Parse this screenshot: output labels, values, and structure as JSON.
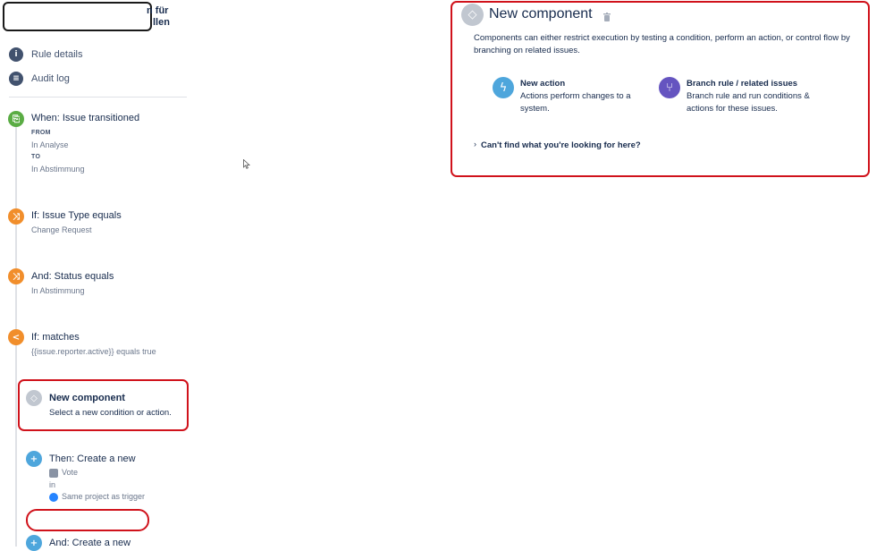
{
  "header": {
    "title_tail_line1": "n für",
    "title_tail_line2": "llen"
  },
  "nav": {
    "rule_details": "Rule details",
    "audit_log": "Audit log"
  },
  "timeline": {
    "trigger": {
      "title": "When: Issue transitioned",
      "from_label": "FROM",
      "from_value": "In Analyse",
      "to_label": "TO",
      "to_value": "In Abstimmung"
    },
    "cond1": {
      "title": "If: Issue Type equals",
      "sub": "Change Request"
    },
    "cond2": {
      "title": "And: Status equals",
      "sub": "In Abstimmung"
    },
    "cond3": {
      "title": "If: matches",
      "sub": "{{issue.reporter.active}} equals true"
    },
    "new_component": {
      "title": "New component",
      "sub": "Select a new condition or action."
    },
    "action1": {
      "title": "Then: Create a new",
      "type": "Vote",
      "in": "in",
      "project": "Same project as trigger"
    },
    "action2": {
      "title": "And: Create a new"
    }
  },
  "panel": {
    "title": "New component",
    "description": "Components can either restrict execution by testing a condition, perform an action, or control flow by branching on related issues.",
    "options": [
      {
        "title": "New action",
        "desc": "Actions perform changes to a system.",
        "icon": "lightning-icon",
        "color": "#4ea6dc"
      },
      {
        "title": "Branch rule / related issues",
        "desc": "Branch rule and run conditions & actions for these issues.",
        "icon": "branch-icon",
        "color": "#6554c0"
      }
    ],
    "help_link": "Can't find what you're looking for here?"
  },
  "colors": {
    "highlight": "#d0121b",
    "trigger": "#5aac44",
    "condition": "#f18e2b",
    "action": "#4ea6dc",
    "branch": "#6554c0"
  }
}
